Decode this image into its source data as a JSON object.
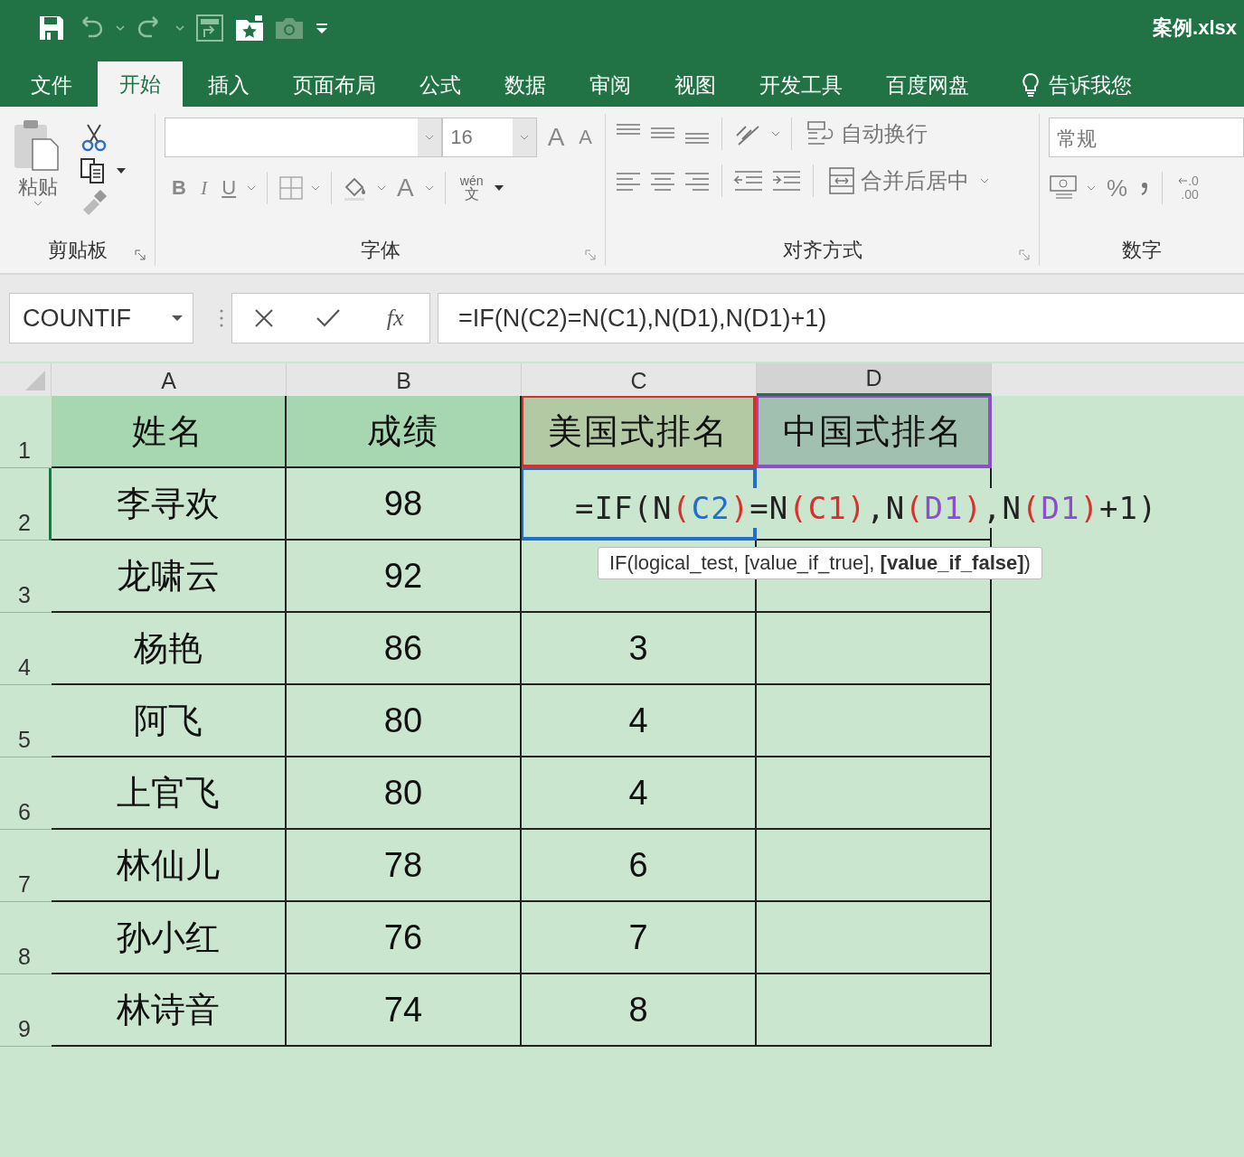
{
  "title_bar": {
    "filename": "案例.xlsx"
  },
  "tabs": [
    {
      "label": "文件",
      "selected": false
    },
    {
      "label": "开始",
      "selected": true
    },
    {
      "label": "插入",
      "selected": false
    },
    {
      "label": "页面布局",
      "selected": false
    },
    {
      "label": "公式",
      "selected": false
    },
    {
      "label": "数据",
      "selected": false
    },
    {
      "label": "审阅",
      "selected": false
    },
    {
      "label": "视图",
      "selected": false
    },
    {
      "label": "开发工具",
      "selected": false
    },
    {
      "label": "百度网盘",
      "selected": false
    },
    {
      "label": "告诉我您",
      "selected": false,
      "kind": "tell"
    }
  ],
  "ribbon": {
    "clipboard": {
      "paste": "粘贴",
      "group_label": "剪贴板"
    },
    "font": {
      "font_size": "16",
      "grow": "A",
      "shrink": "A",
      "bold": "B",
      "italic": "I",
      "underline": "U",
      "font_color": "A",
      "phonetic_top": "wén",
      "phonetic_bottom": "文",
      "group_label": "字体"
    },
    "alignment": {
      "wrap_text": "自动换行",
      "merge_center": "合并后居中",
      "group_label": "对齐方式"
    },
    "number": {
      "format": "常规",
      "percent": "%",
      "decimal_top": ".0",
      "decimal_bottom": ".00",
      "group_label": "数字"
    }
  },
  "formula_bar": {
    "name_box": "COUNTIF",
    "fx": "fx",
    "formula": "=IF(N(C2)=N(C1),N(D1),N(D1)+1)"
  },
  "sheet": {
    "columns": [
      {
        "label": "A",
        "selected": false
      },
      {
        "label": "B",
        "selected": false
      },
      {
        "label": "C",
        "selected": false
      },
      {
        "label": "D",
        "selected": true
      }
    ],
    "rows": [
      {
        "number": "1",
        "selected": false,
        "header": true,
        "cells": [
          {
            "text": "姓名"
          },
          {
            "text": "成绩"
          },
          {
            "text": "美国式排名",
            "color": "#d9302b"
          },
          {
            "text": "中国式排名",
            "color": "#8a4fc9"
          }
        ]
      },
      {
        "number": "2",
        "selected": true,
        "header": false,
        "cells": [
          {
            "text": "李寻欢"
          },
          {
            "text": "98"
          },
          {
            "color": "#1f6fd1"
          }
        ]
      },
      {
        "number": "3",
        "selected": false,
        "header": false,
        "cells": [
          {
            "text": "龙啸云"
          },
          {
            "text": "92"
          }
        ]
      },
      {
        "number": "4",
        "selected": false,
        "header": false,
        "cells": [
          {
            "text": "杨艳"
          },
          {
            "text": "86"
          },
          {
            "text": "3"
          }
        ]
      },
      {
        "number": "5",
        "selected": false,
        "header": false,
        "cells": [
          {
            "text": "阿飞"
          },
          {
            "text": "80"
          },
          {
            "text": "4"
          }
        ]
      },
      {
        "number": "6",
        "selected": false,
        "header": false,
        "cells": [
          {
            "text": "上官飞"
          },
          {
            "text": "80"
          },
          {
            "text": "4"
          }
        ]
      },
      {
        "number": "7",
        "selected": false,
        "header": false,
        "cells": [
          {
            "text": "林仙儿"
          },
          {
            "text": "78"
          },
          {
            "text": "6"
          }
        ]
      },
      {
        "number": "8",
        "selected": false,
        "header": false,
        "cells": [
          {
            "text": "孙小红"
          },
          {
            "text": "76"
          },
          {
            "text": "7"
          }
        ]
      },
      {
        "number": "9",
        "selected": false,
        "header": false,
        "cells": [
          {
            "text": "林诗音"
          },
          {
            "text": "74"
          },
          {
            "text": "8"
          }
        ]
      }
    ],
    "editing": {
      "segments": [
        {
          "text": "=IF(N",
          "color": "#222222"
        },
        {
          "text": "(",
          "color": "#d9302b"
        },
        {
          "text": "C2",
          "color": "#1f6fd1"
        },
        {
          "text": ")",
          "color": "#d9302b"
        },
        {
          "text": "=N",
          "color": "#222222"
        },
        {
          "text": "(",
          "color": "#d9302b"
        },
        {
          "text": "C1",
          "color": "#d9302b"
        },
        {
          "text": ")",
          "color": "#d9302b"
        },
        {
          "text": ",N",
          "color": "#222222"
        },
        {
          "text": "(",
          "color": "#d9302b"
        },
        {
          "text": "D1",
          "color": "#8a4fc9"
        },
        {
          "text": ")",
          "color": "#d9302b"
        },
        {
          "text": ",N",
          "color": "#222222"
        },
        {
          "text": "(",
          "color": "#d9302b"
        },
        {
          "text": "D1",
          "color": "#8a4fc9"
        },
        {
          "text": ")",
          "color": "#d9302b"
        },
        {
          "text": "+1)",
          "color": "#222222"
        }
      ]
    },
    "tooltip": "IF(logical_test, [value_if_true], **[value_if_false]**)"
  }
}
